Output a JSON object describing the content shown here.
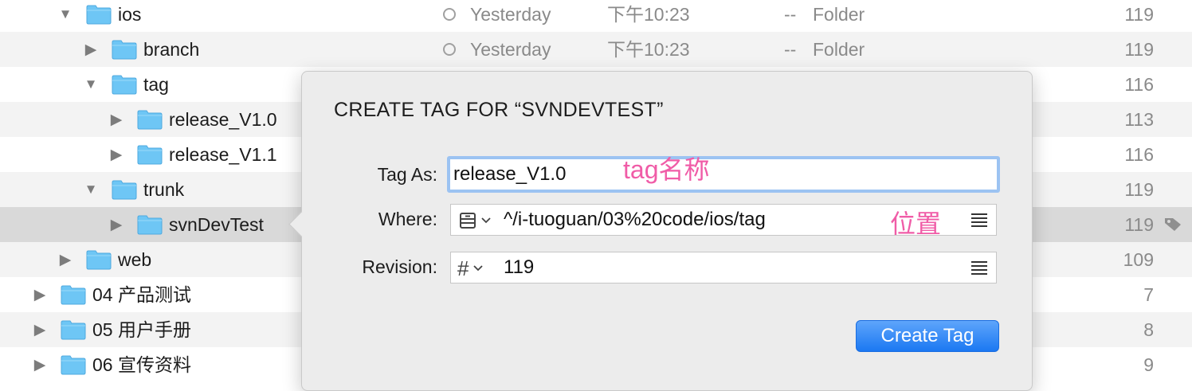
{
  "rows": [
    {
      "name": "ios",
      "expanded": true,
      "depth": 0,
      "status": true,
      "date": "Yesterday",
      "time": "下午10:23",
      "size": "--",
      "kind": "Folder",
      "count": "119"
    },
    {
      "name": "branch",
      "expanded": false,
      "depth": 1,
      "status": true,
      "date": "Yesterday",
      "time": "下午10:23",
      "size": "--",
      "kind": "Folder",
      "count": "119"
    },
    {
      "name": "tag",
      "expanded": true,
      "depth": 1,
      "count": "116"
    },
    {
      "name": "release_V1.0",
      "expanded": false,
      "depth": 2,
      "count": "113"
    },
    {
      "name": "release_V1.1",
      "expanded": false,
      "depth": 2,
      "count": "116"
    },
    {
      "name": "trunk",
      "expanded": true,
      "depth": 1,
      "count": "119"
    },
    {
      "name": "svnDevTest",
      "expanded": false,
      "depth": 2,
      "count": "119",
      "selected": true,
      "tagged": true
    },
    {
      "name": "web",
      "expanded": false,
      "depth": 0,
      "count": "109"
    },
    {
      "name": "04 产品测试",
      "expanded": false,
      "depth": -1,
      "count": "7"
    },
    {
      "name": "05 用户手册",
      "expanded": false,
      "depth": -1,
      "count": "8"
    },
    {
      "name": "06 宣传资料",
      "expanded": false,
      "depth": -1,
      "count": "9"
    }
  ],
  "dialog": {
    "title": "CREATE TAG FOR “SVNDEVTEST”",
    "tag_as_label": "Tag As:",
    "tag_as_value": "release_V1.0",
    "where_label": "Where:",
    "where_value": "^/i-tuoguan/03%20code/ios/tag",
    "revision_label": "Revision:",
    "revision_value": "119",
    "revision_symbol": "#",
    "create_button": "Create Tag"
  },
  "annotations": {
    "tag_name": "tag名称",
    "location": "位置"
  },
  "colors": {
    "folder": "#6ec6f5",
    "annotation": "#f05ca7",
    "button": "#1b78f2",
    "focus_ring": "#9cc3f2"
  },
  "icons": {
    "disclosure_open": "triangle-down-icon",
    "disclosure_closed": "triangle-right-icon",
    "folder": "folder-icon",
    "status": "status-circle-icon",
    "tag": "tag-icon",
    "repository": "repository-icon",
    "menu": "list-menu-icon",
    "chevron": "chevron-down-icon"
  }
}
